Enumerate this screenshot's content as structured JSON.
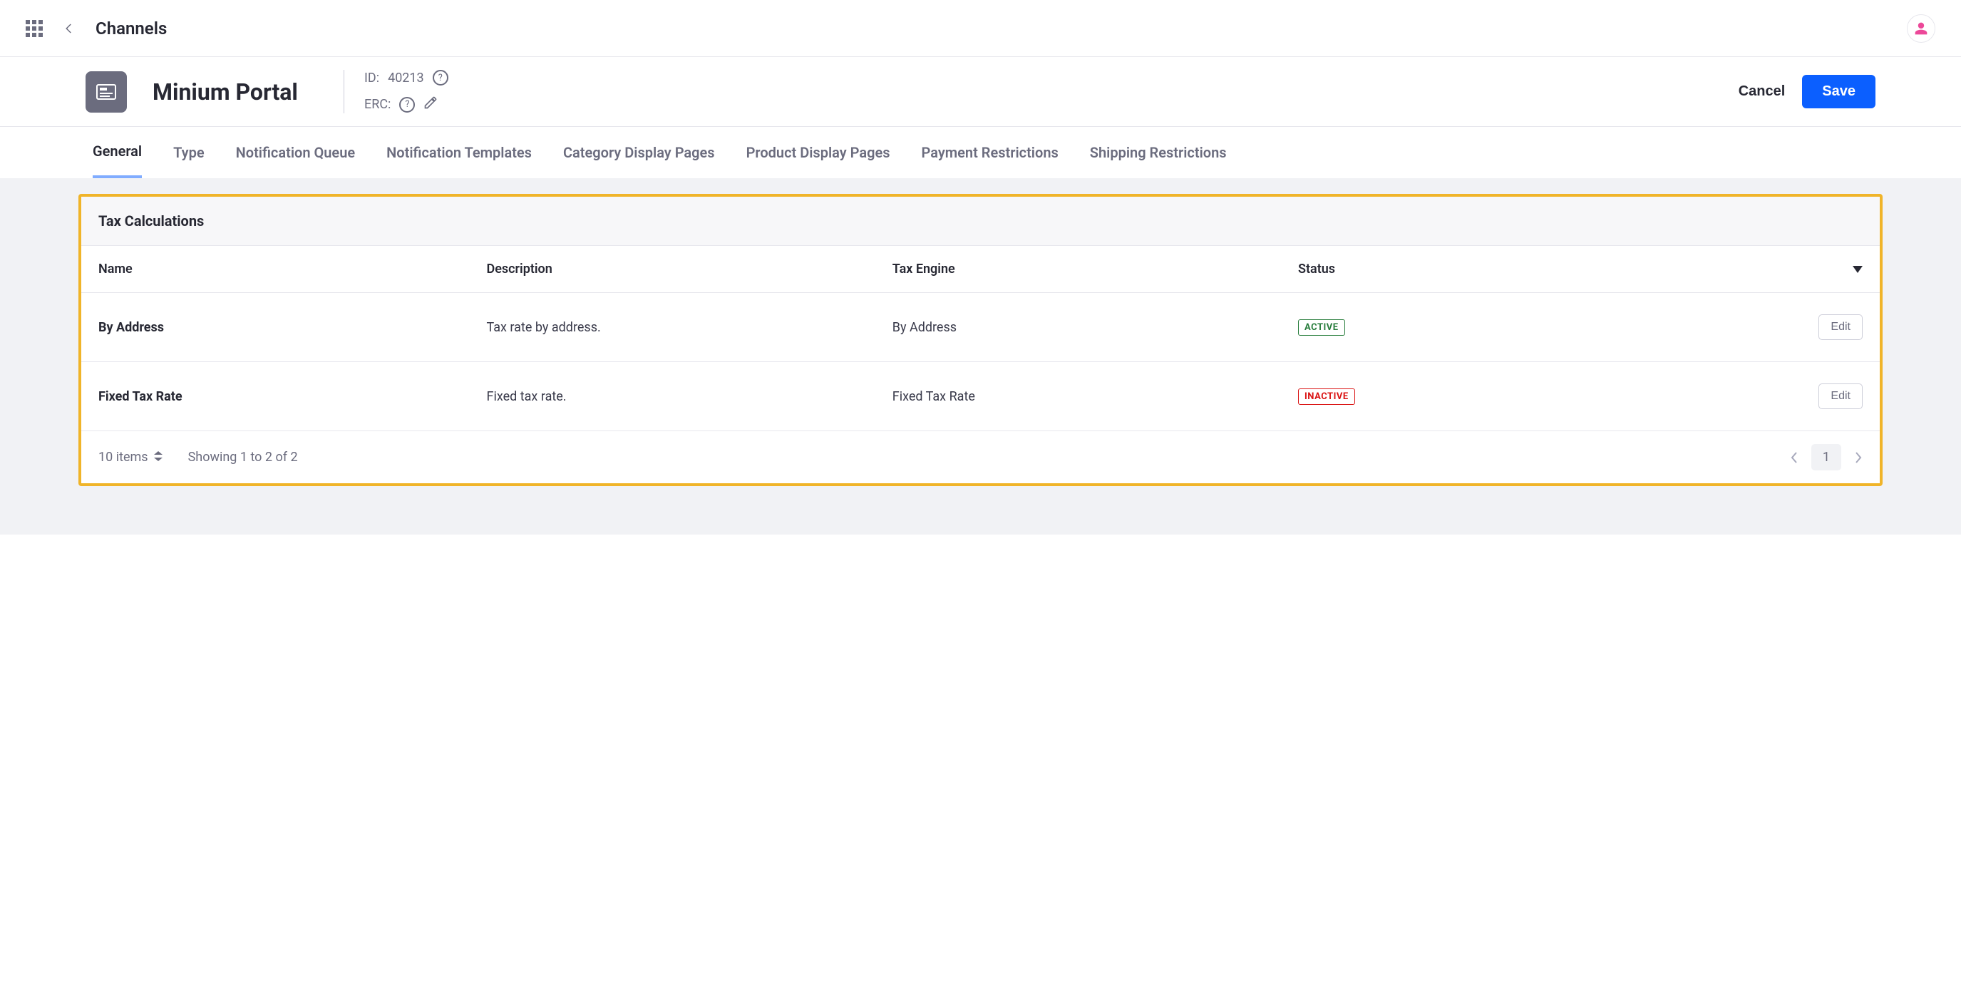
{
  "topbar": {
    "breadcrumb": "Channels"
  },
  "header": {
    "title": "Minium Portal",
    "id_label": "ID:",
    "id_value": "40213",
    "erc_label": "ERC:",
    "cancel": "Cancel",
    "save": "Save"
  },
  "tabs": [
    {
      "label": "General",
      "active": true
    },
    {
      "label": "Type",
      "active": false
    },
    {
      "label": "Notification Queue",
      "active": false
    },
    {
      "label": "Notification Templates",
      "active": false
    },
    {
      "label": "Category Display Pages",
      "active": false
    },
    {
      "label": "Product Display Pages",
      "active": false
    },
    {
      "label": "Payment Restrictions",
      "active": false
    },
    {
      "label": "Shipping Restrictions",
      "active": false
    }
  ],
  "panel": {
    "title": "Tax Calculations",
    "columns": {
      "name": "Name",
      "description": "Description",
      "engine": "Tax Engine",
      "status": "Status"
    },
    "rows": [
      {
        "name": "By Address",
        "description": "Tax rate by address.",
        "engine": "By Address",
        "status": "ACTIVE",
        "status_class": "active",
        "edit": "Edit"
      },
      {
        "name": "Fixed Tax Rate",
        "description": "Fixed tax rate.",
        "engine": "Fixed Tax Rate",
        "status": "INACTIVE",
        "status_class": "inactive",
        "edit": "Edit"
      }
    ],
    "footer": {
      "page_size": "10 items",
      "showing": "Showing 1 to 2 of 2",
      "current_page": "1"
    }
  }
}
